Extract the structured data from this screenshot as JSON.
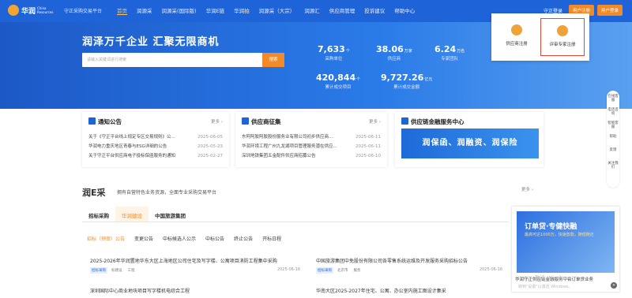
{
  "nav": {
    "logo_cn": "华润",
    "logo_en": "China Resources",
    "subtitle": "守正采购交易平台",
    "menu": [
      "首页",
      "润源采",
      "润源采(国际版)",
      "华润E链",
      "华润拍",
      "润源采（大宗）",
      "润源汇",
      "供应商管理",
      "投诉建议",
      "帮助中心"
    ],
    "login": "守正登录",
    "btn1": "用户注册",
    "btn2": "用户登录"
  },
  "popup": {
    "opt1": "供应商注册",
    "opt2": "评审专家注册"
  },
  "hero": {
    "slogan": "润泽万千企业 汇聚无限商机",
    "search_placeholder": "请输入关键词进行搜索",
    "search_btn": "搜索",
    "stats": [
      {
        "num": "7,633",
        "unit": "个",
        "label": "采购单位"
      },
      {
        "num": "38.06",
        "unit": "万家",
        "label": "供应商"
      },
      {
        "num": "6.24",
        "unit": "万名",
        "label": "专家团队"
      },
      {
        "num": "420,844",
        "unit": "个",
        "label": "累计成交项目"
      },
      {
        "num": "9,727.26",
        "unit": "亿元",
        "label": "累计成交金额"
      }
    ]
  },
  "notice": {
    "title": "通知公告",
    "more": "更多 ›",
    "rows": [
      [
        "关于《守正平台线上规定专区交易规则》公...",
        "2025-06-05"
      ],
      [
        "华润电力重庆地区青春与ESG详细的公告",
        "2025-05-23"
      ],
      [
        "关于守正平台供应商电子投标保函服务的通知",
        "2025-02-27"
      ]
    ]
  },
  "supplier": {
    "title": "供应商征集",
    "more": "更多 ›",
    "rows": [
      [
        "东阿阿胶阿胶股份服务业有限公司初步供应商...",
        "2025-06-11"
      ],
      [
        "华润环境工程广州九龙湖项目管理服务潜在供应...",
        "2025-06-11"
      ],
      [
        "深圳地铁集团五金配件供应商招募公告",
        "2025-06-10"
      ]
    ]
  },
  "finance": {
    "title": "供应链金融服务中心",
    "banner": "润保函、润融资、润保险"
  },
  "section": {
    "title": "润E采",
    "subtitle": "拥有自营特色业务资源，全面专业采购交易平台",
    "more": "更多 ›",
    "tabs": [
      "招标采购",
      "华润建设",
      "中国旅游集团"
    ],
    "subtabs": [
      "招标（预审）公告",
      "变更公告",
      "中标候选人公示",
      "中标公告",
      "终止公告",
      "开标日程"
    ]
  },
  "items": [
    {
      "title": "2025-2026年华润置地华东大区上海地区公司住宅及写字楼、公寓项目消防工程集中采购",
      "tags": [
        "招标采购",
        "标建设",
        "工程"
      ],
      "date": "2025-06-16"
    },
    {
      "title": "中国旅游集团中免股份有限公司各零售系统运维及开发服务采购招标公告",
      "tags": [
        "招标采购",
        "北京市",
        "服务"
      ],
      "date": "2025-06-16"
    },
    {
      "title": "深圳国际中心商业地块项目写字楼机电综合工程",
      "tags": [],
      "date": ""
    },
    {
      "title": "华南大区2025-2027年住宅、公寓、办公室内施工图设计集采",
      "tags": [],
      "date": ""
    }
  ],
  "side": [
    "在线客服",
    "电话咨询",
    "智能客服",
    "帮助",
    "反馈",
    "关注我们"
  ],
  "ad": {
    "headline": "订单贷·专健快融",
    "tag": "最高可达1000万，快速放款，随借随还",
    "text": "华润守正供应链金融服务平台订单贷业务"
  },
  "watermark": {
    "line1": "激活 Windows",
    "line2": "转到\"设置\"以激活 Windows。"
  }
}
